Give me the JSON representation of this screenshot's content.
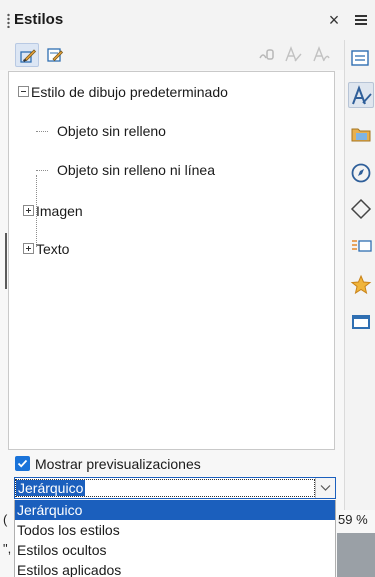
{
  "panel": {
    "title": "Estilos",
    "close_glyph": "×"
  },
  "toolbar": {
    "left_buttons": [
      "drawing-styles-icon",
      "presentation-styles-icon"
    ],
    "right_buttons": [
      "fill-format-icon",
      "new-style-icon",
      "update-style-icon"
    ]
  },
  "tree": {
    "items": [
      {
        "label": "Estilo de dibujo predeterminado",
        "expander": "−"
      },
      {
        "label": "Objeto sin relleno"
      },
      {
        "label": "Objeto sin relleno ni línea"
      },
      {
        "label": "Imagen",
        "expander": "+"
      },
      {
        "label": "Texto",
        "expander": "+"
      }
    ]
  },
  "preview_checkbox": {
    "label": "Mostrar previsualizaciones",
    "checked": true
  },
  "filter": {
    "value": "Jerárquico",
    "options": [
      "Jerárquico",
      "Todos los estilos",
      "Estilos ocultos",
      "Estilos aplicados"
    ],
    "selected_index": 0
  },
  "background": {
    "left_fragment_1": "(",
    "left_fragment_2": "\",",
    "zoom": "59 %"
  },
  "sidebar": {
    "buttons": [
      "properties-icon",
      "styles-icon",
      "gallery-icon",
      "navigator-icon",
      "shapes-icon",
      "slide-transition-icon",
      "animation-icon",
      "master-slides-icon"
    ],
    "active": "styles-icon"
  },
  "colors": {
    "accent": "#1b5fbd",
    "checkbox": "#1a73d9"
  }
}
